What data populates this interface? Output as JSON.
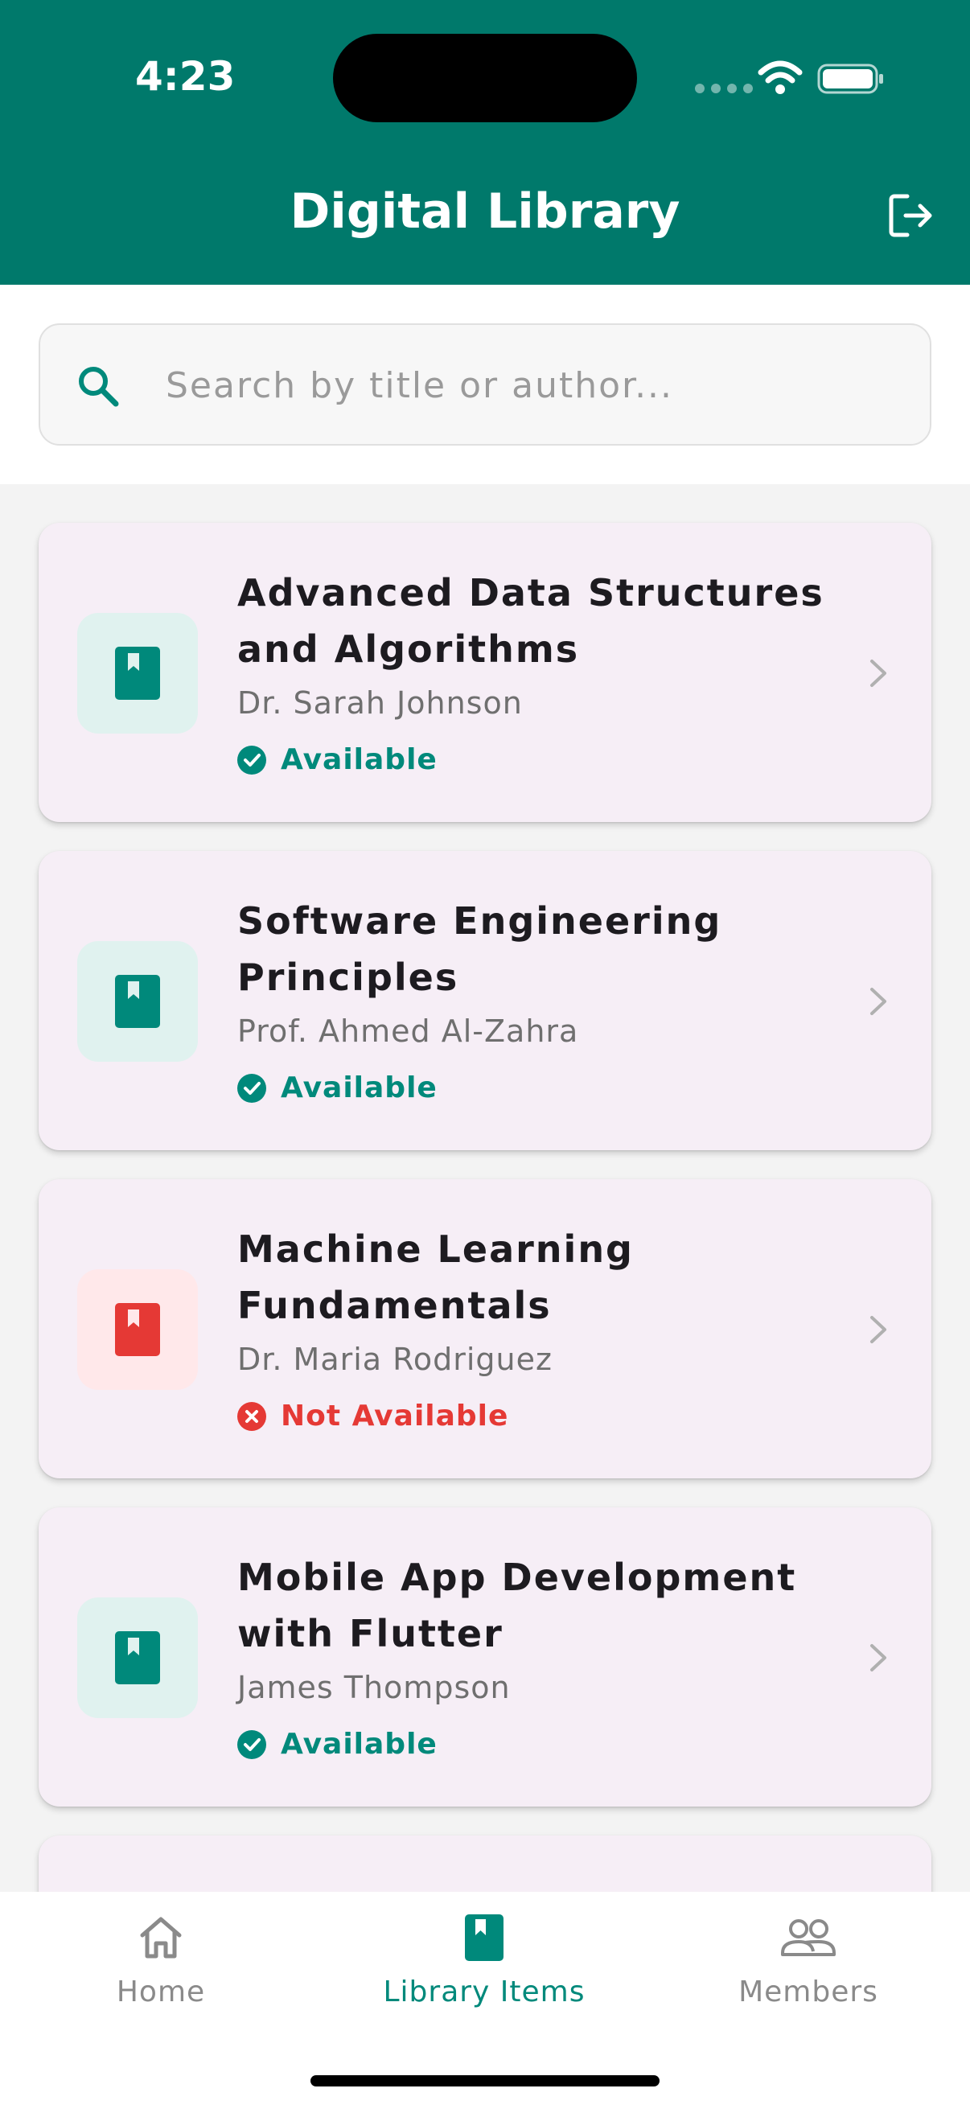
{
  "status_bar": {
    "time": "4:23",
    "icons": [
      "cellular-signal-icon",
      "wifi-icon",
      "battery-icon"
    ]
  },
  "header": {
    "title": "Digital Library",
    "action_icon": "logout-icon"
  },
  "search": {
    "placeholder": "Search by title or author...",
    "icon": "search-icon"
  },
  "books": [
    {
      "title": "Advanced Data Structures and Algorithms",
      "author": "Dr. Sarah Johnson",
      "status": "Available",
      "available": true
    },
    {
      "title": "Software Engineering Principles",
      "author": "Prof. Ahmed Al-Zahra",
      "status": "Available",
      "available": true
    },
    {
      "title": "Machine Learning Fundamentals",
      "author": "Dr. Maria Rodriguez",
      "status": "Not Available",
      "available": false
    },
    {
      "title": "Mobile App Development with Flutter",
      "author": "James Thompson",
      "status": "Available",
      "available": true
    }
  ],
  "bottom_nav": {
    "items": [
      {
        "label": "Home",
        "icon": "home-icon",
        "active": false
      },
      {
        "label": "Library Items",
        "icon": "book-icon",
        "active": true
      },
      {
        "label": "Members",
        "icon": "members-icon",
        "active": false
      }
    ]
  },
  "colors": {
    "primary": "#00796b",
    "available": "#00897b",
    "not_available": "#e53935",
    "card_background": "#f6eef6"
  }
}
